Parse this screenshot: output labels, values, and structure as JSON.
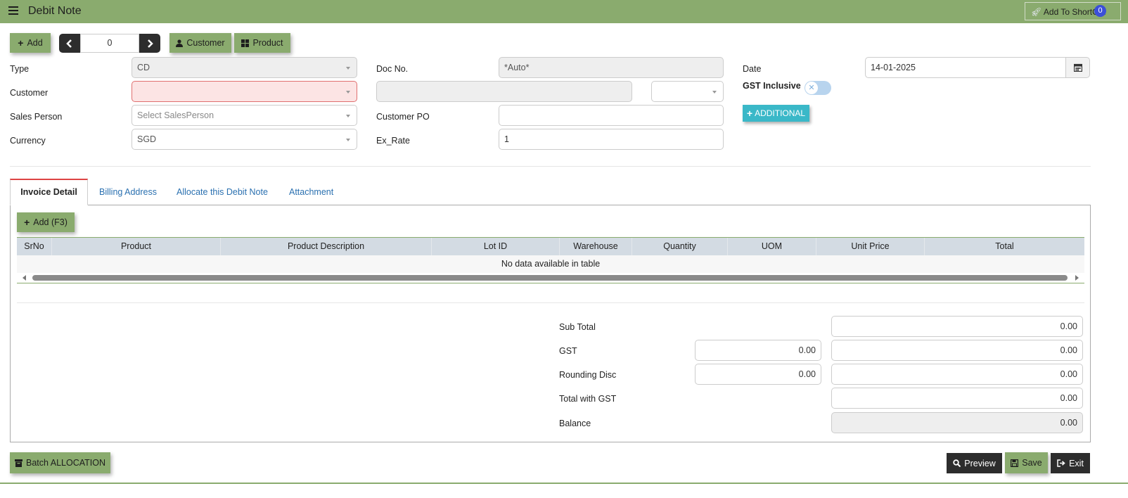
{
  "header": {
    "title": "Debit Note",
    "shortcut_label": "Add To ShortCut",
    "shortcut_count": "0"
  },
  "toolbar": {
    "add_label": "Add",
    "record_index": "0",
    "customer_label": "Customer",
    "product_label": "Product"
  },
  "form": {
    "type_label": "Type",
    "type_value": "CD",
    "customer_label": "Customer",
    "customer_value": "",
    "customer_name_value": "",
    "customer_extra_value": "",
    "sales_person_label": "Sales Person",
    "sales_person_placeholder": "Select SalesPerson",
    "currency_label": "Currency",
    "currency_value": "SGD",
    "doc_no_label": "Doc No.",
    "doc_no_value": "*Auto*",
    "customer_po_label": "Customer PO",
    "customer_po_value": "",
    "ex_rate_label": "Ex_Rate",
    "ex_rate_value": "1",
    "date_label": "Date",
    "date_value": "14-01-2025",
    "gst_inclusive_label": "GST Inclusive",
    "gst_inclusive_on": false,
    "additional_label": "ADDITIONAL"
  },
  "tabs": [
    {
      "label": "Invoice Detail",
      "active": true
    },
    {
      "label": "Billing Address",
      "active": false
    },
    {
      "label": "Allocate this Debit Note",
      "active": false
    },
    {
      "label": "Attachment",
      "active": false
    }
  ],
  "detail": {
    "add_label": "Add (F3)",
    "columns": [
      "SrNo",
      "Product",
      "Product Description",
      "Lot ID",
      "Warehouse",
      "Quantity",
      "UOM",
      "Unit Price",
      "Total"
    ],
    "empty_message": "No data available in table"
  },
  "totals": {
    "sub_total_label": "Sub Total",
    "sub_total_value": "0.00",
    "gst_label": "GST",
    "gst_rate_value": "0.00",
    "gst_value": "0.00",
    "rounding_label": "Rounding Disc",
    "rounding_rate_value": "0.00",
    "rounding_value": "0.00",
    "total_gst_label": "Total with GST",
    "total_gst_value": "0.00",
    "balance_label": "Balance",
    "balance_value": "0.00"
  },
  "footer": {
    "batch_label": "Batch ALLOCATION",
    "preview_label": "Preview",
    "save_label": "Save",
    "exit_label": "Exit"
  },
  "colors": {
    "header_green": "#8aab6e",
    "grid_header": "#d3dbe3",
    "additional_teal": "#3ab8c8",
    "error_pink": "#fce4e4"
  }
}
